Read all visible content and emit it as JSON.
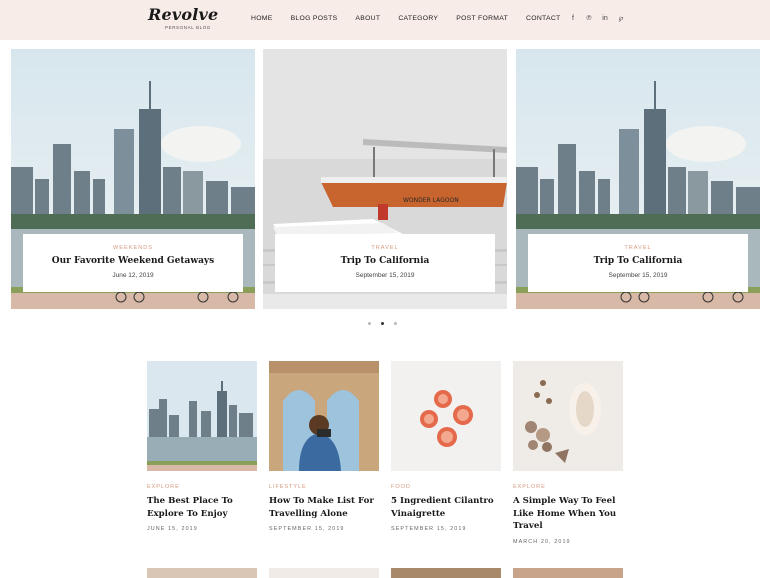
{
  "header": {
    "logo": "Revolve",
    "tagline": "PERSONAL BLOG",
    "nav": [
      "HOME",
      "BLOG POSTS",
      "ABOUT",
      "CATEGORY",
      "POST FORMAT",
      "CONTACT"
    ],
    "social": [
      {
        "icon": "facebook-icon",
        "glyph": "f"
      },
      {
        "icon": "pinterest-icon",
        "glyph": "℗"
      },
      {
        "icon": "linkedin-icon",
        "glyph": "in"
      },
      {
        "icon": "pinterest-p-icon",
        "glyph": "℘"
      }
    ]
  },
  "slider": {
    "slides": [
      {
        "category": "WEEKENDS",
        "title": "Our Favorite Weekend Getaways",
        "date": "June 12, 2019"
      },
      {
        "category": "TRAVEL",
        "title": "Trip To California",
        "date": "September 15, 2019"
      },
      {
        "category": "TRAVEL",
        "title": "Trip To California",
        "date": "September 15, 2019"
      }
    ],
    "boat_name": "WONDER LAGOON"
  },
  "posts": [
    {
      "category": "EXPLORE",
      "title": "The Best Place To Explore To Enjoy",
      "date": "JUNE 15, 2019"
    },
    {
      "category": "LIFESTYLE",
      "title": "How To Make List For Travelling Alone",
      "date": "SEPTEMBER 15, 2019"
    },
    {
      "category": "FOOD",
      "title": "5 Ingredient Cilantro Vinaigrette",
      "date": "SEPTEMBER 15, 2019"
    },
    {
      "category": "EXPLORE",
      "title": "A Simple Way To Feel Like Home When You Travel",
      "date": "MARCH 20, 2019"
    }
  ],
  "colors": {
    "header_bg": "#f8ece8",
    "accent": "#d49a7f"
  }
}
